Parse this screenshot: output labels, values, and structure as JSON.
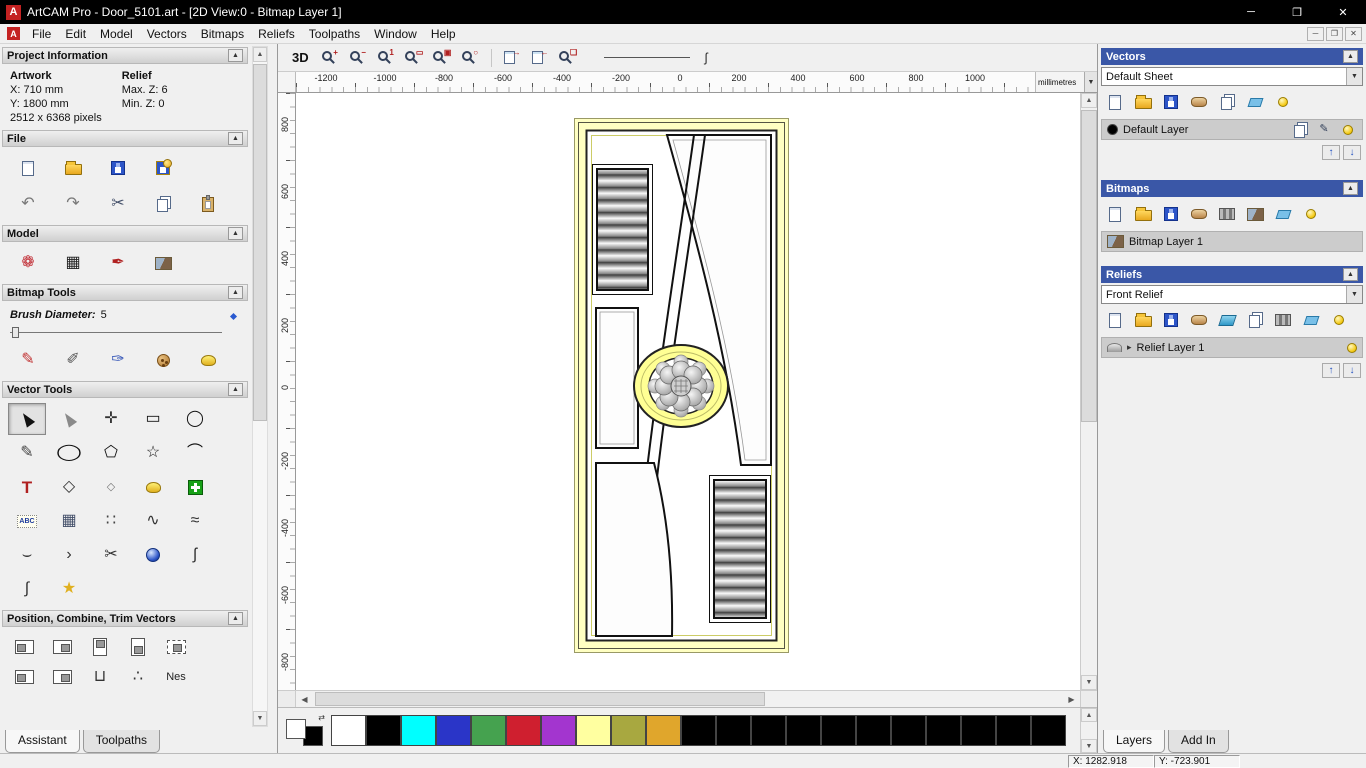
{
  "window": {
    "title": "ArtCAM Pro - Door_5101.art - [2D View:0 - Bitmap Layer 1]",
    "logo_letter": "A",
    "controls": {
      "minimize": "─",
      "restore": "❐",
      "close": "✕"
    }
  },
  "menu": {
    "items": [
      {
        "name": "menu-file",
        "label": "File"
      },
      {
        "name": "menu-edit",
        "label": "Edit"
      },
      {
        "name": "menu-model",
        "label": "Model"
      },
      {
        "name": "menu-vectors",
        "label": "Vectors"
      },
      {
        "name": "menu-bitmaps",
        "label": "Bitmaps"
      },
      {
        "name": "menu-reliefs",
        "label": "Reliefs"
      },
      {
        "name": "menu-toolpaths",
        "label": "Toolpaths"
      },
      {
        "name": "menu-window",
        "label": "Window"
      },
      {
        "name": "menu-help",
        "label": "Help"
      }
    ]
  },
  "ui": {
    "collapse_glyph": "▲",
    "combo_arrow": "▼",
    "scroll_up": "▲",
    "scroll_down": "▼",
    "scroll_left": "◀",
    "scroll_right": "▶",
    "layer_up": "↑",
    "layer_down": "↓",
    "expand_glyph": "▸",
    "swap_glyph": "⇄"
  },
  "left_panel": {
    "project_info": {
      "title": "Project Information",
      "artwork_label": "Artwork",
      "relief_label": "Relief",
      "x": "X: 710 mm",
      "y": "Y: 1800 mm",
      "max_z": "Max. Z: 6",
      "min_z": "Min. Z: 0",
      "pixels": "2512 x 6368 pixels"
    },
    "file": {
      "title": "File",
      "row1": [
        {
          "name": "new-model-icon",
          "cls": "ic-page"
        },
        {
          "name": "open-model-icon",
          "cls": "ic-folder"
        },
        {
          "name": "save-model-icon",
          "cls": "ic-disk"
        },
        {
          "name": "save-as-icon",
          "cls": "ic-disk2"
        }
      ],
      "row2": [
        {
          "name": "undo-icon",
          "glyph": "↶",
          "color": "#777777"
        },
        {
          "name": "redo-icon",
          "glyph": "↷",
          "color": "#777777"
        },
        {
          "name": "cut-icon",
          "glyph": "✂",
          "color": "#44506a"
        },
        {
          "name": "copy-icon",
          "cls": "ic-pages"
        },
        {
          "name": "paste-icon",
          "cls": "ic-clipboard"
        }
      ]
    },
    "model": {
      "title": "Model",
      "icons": [
        {
          "name": "shape-editor-icon",
          "glyph": "❁",
          "color": "#c02830"
        },
        {
          "name": "greyscale-preview-icon",
          "glyph": "▦",
          "color": "#222222"
        },
        {
          "name": "relief-painting-icon",
          "glyph": "✒",
          "color": "#b02020"
        },
        {
          "name": "preview-model-icon",
          "cls": "ic-pic"
        }
      ]
    },
    "bitmap_tools": {
      "title": "Bitmap Tools",
      "brush_label": "Brush Diameter:",
      "brush_value": "5",
      "icons": [
        {
          "name": "paint-brush-icon",
          "glyph": "✎",
          "color": "#c03030"
        },
        {
          "name": "paint-selective-icon",
          "glyph": "✐",
          "color": "#555555"
        },
        {
          "name": "eyedropper-icon",
          "glyph": "✑",
          "color": "#3858b8"
        },
        {
          "name": "cookie-cutter-icon",
          "cls": "ic-cookie"
        },
        {
          "name": "flood-fill-icon",
          "cls": "ic-blob-yellow"
        }
      ]
    },
    "vector_tools": {
      "title": "Vector Tools",
      "tools": [
        {
          "name": "select-vectors-icon",
          "cls": "ic-cursor",
          "active": true
        },
        {
          "name": "node-editing-icon",
          "cls": "ic-cursor2"
        },
        {
          "name": "transform-vectors-icon",
          "glyph": "✛",
          "color": "#333333"
        },
        {
          "name": "create-rectangle-icon",
          "glyph": "▭",
          "color": "#111111"
        },
        {
          "name": "create-circle-icon",
          "glyph": "◯",
          "color": "#111111"
        },
        {
          "name": "create-polyline-icon",
          "glyph": "✎",
          "color": "#444444"
        },
        {
          "name": "create-ellipse-icon",
          "glyph": "◯",
          "cls": "wide",
          "color": "#111111"
        },
        {
          "name": "create-polygon-icon",
          "glyph": "⬠",
          "color": "#111111"
        },
        {
          "name": "create-star-icon",
          "glyph": "☆",
          "color": "#111111"
        },
        {
          "name": "create-arc-icon",
          "glyph": "⌒",
          "color": "#111111"
        },
        {
          "name": "create-text-icon",
          "glyph": "T",
          "cls": "bold",
          "color": "#b02020"
        },
        {
          "name": "measure-icon",
          "glyph": "◇",
          "color": "#333333"
        },
        {
          "name": "offset-vectors-icon",
          "glyph": "◇",
          "cls": "sm",
          "color": "#777777"
        },
        {
          "name": "doodle-icon",
          "cls": "ic-blob-yellow"
        },
        {
          "name": "paste-special-icon",
          "cls": "ic-plus-green"
        },
        {
          "name": "text-block-icon",
          "glyph": "ABC",
          "cls": "ic-abc"
        },
        {
          "name": "create-grid-icon",
          "glyph": "▦",
          "color": "#44506a"
        },
        {
          "name": "block-paste-icon",
          "glyph": "∷",
          "color": "#444444"
        },
        {
          "name": "fit-polyline-icon",
          "glyph": "∿",
          "color": "#333333"
        },
        {
          "name": "fit-arcs-icon",
          "glyph": "≈",
          "color": "#333333"
        },
        {
          "name": "join-close-vectors-icon",
          "glyph": "⌣",
          "color": "#333333"
        },
        {
          "name": "extend-vectors-icon",
          "glyph": "›",
          "color": "#333333"
        },
        {
          "name": "trim-vectors-icon",
          "glyph": "✂",
          "color": "#333333"
        },
        {
          "name": "interactive-distortion-icon",
          "cls": "ic-sphere"
        },
        {
          "name": "fillet-icon",
          "glyph": "ʃ",
          "color": "#333333"
        },
        {
          "name": "vector-doctor-icon",
          "glyph": "∫",
          "color": "#333333"
        },
        {
          "name": "wrap-star-icon",
          "glyph": "★",
          "color": "#e0b020"
        }
      ]
    },
    "position_tools": {
      "title": "Position, Combine, Trim Vectors",
      "row1": [
        {
          "name": "align-left-icon",
          "cls": "ai-l"
        },
        {
          "name": "align-right-icon",
          "cls": "ai-r"
        },
        {
          "name": "align-top-icon",
          "cls": "ai-t"
        },
        {
          "name": "align-bottom-icon",
          "cls": "ai-b"
        },
        {
          "name": "align-centre-icon",
          "cls": "ai-c"
        }
      ],
      "row2": [
        {
          "name": "group-vectors-icon",
          "cls": "ai-l"
        },
        {
          "name": "ungroup-vectors-icon",
          "cls": "ai-r"
        },
        {
          "name": "weld-vectors-icon",
          "glyph": "⊔",
          "color": "#333333"
        },
        {
          "name": "snap-dots-icon",
          "glyph": "∴",
          "color": "#333333"
        },
        {
          "name": "nesting-icon",
          "glyph": "Nes",
          "cls": "sm",
          "color": "#222222"
        }
      ]
    },
    "tabs": [
      {
        "name": "tab-assistant",
        "label": "Assistant",
        "active": true
      },
      {
        "name": "tab-toolpaths",
        "label": "Toolpaths",
        "active": false
      }
    ]
  },
  "canvas": {
    "toolbar": {
      "view3d_label": "3D",
      "zoom_icons": [
        {
          "name": "zoom-in-icon",
          "cls": "ic-zoom",
          "badge": "+"
        },
        {
          "name": "zoom-out-icon",
          "cls": "ic-zoom",
          "badge": "−"
        },
        {
          "name": "zoom-1to1-icon",
          "cls": "ic-zoom",
          "badge": "1"
        },
        {
          "name": "zoom-window-icon",
          "cls": "ic-zoom",
          "badge": "▭"
        },
        {
          "name": "zoom-fit-icon",
          "cls": "ic-zoom",
          "badge": "▣"
        },
        {
          "name": "zoom-objects-icon",
          "cls": "ic-zoom",
          "badge": "○"
        }
      ],
      "snap_icons": [
        {
          "name": "snap-grid-toggle-icon",
          "cls": "ic-pagearrow",
          "badge": "→"
        },
        {
          "name": "snap-guides-toggle-icon",
          "cls": "ic-pagearrow",
          "badge": "←"
        },
        {
          "name": "zoom-page-icon",
          "cls": "ic-zoom",
          "badge": "❏"
        }
      ]
    },
    "ruler": {
      "h_labels": [
        "-1200",
        "-1000",
        "-800",
        "-600",
        "-400",
        "-200",
        "0",
        "200",
        "400",
        "600",
        "800",
        "1000"
      ],
      "v_labels": [
        "800",
        "600",
        "400",
        "200",
        "0",
        "-200",
        "-400",
        "-600",
        "-800"
      ],
      "units": "millimetres"
    }
  },
  "palette": {
    "colors": [
      "#ffffff",
      "#000000",
      "#00ffff",
      "#2a35c8",
      "#45a24f",
      "#cf1f2f",
      "#a335cf",
      "#ffffa0",
      "#a8a840",
      "#e0a62c",
      "#000000",
      "#000000",
      "#000000",
      "#000000",
      "#000000",
      "#000000",
      "#000000",
      "#000000",
      "#000000",
      "#000000",
      "#000000"
    ]
  },
  "right_panel": {
    "vectors": {
      "title": "Vectors",
      "sheet_value": "Default Sheet",
      "toolbar": [
        {
          "name": "new-vector-layer-icon",
          "cls": "ic-page"
        },
        {
          "name": "open-vector-layer-icon",
          "cls": "ic-folder"
        },
        {
          "name": "save-vector-layer-icon",
          "cls": "ic-disk"
        },
        {
          "name": "merge-vector-layers-icon",
          "cls": "ic-loaf"
        },
        {
          "name": "new-sheet-icon",
          "cls": "ic-pages"
        },
        {
          "name": "delete-vector-layer-icon",
          "cls": "ic-eraser"
        },
        {
          "name": "toggle-all-vector-visibility-icon",
          "cls": "ic-bulb"
        }
      ],
      "layer_label": "Default Layer",
      "layer_icons": [
        {
          "name": "snap-layer-icon",
          "cls": "ic-pages"
        },
        {
          "name": "edit-layer-colour-icon",
          "glyph": "✎",
          "color": "#33415a"
        },
        {
          "name": "layer-visibility-icon",
          "cls": "ic-bulb"
        }
      ]
    },
    "bitmaps": {
      "title": "Bitmaps",
      "toolbar": [
        {
          "name": "new-bitmap-layer-icon",
          "cls": "ic-page"
        },
        {
          "name": "open-bitmap-layer-icon",
          "cls": "ic-folder"
        },
        {
          "name": "save-bitmap-layer-icon",
          "cls": "ic-disk"
        },
        {
          "name": "merge-bitmap-layers-icon",
          "cls": "ic-loaf"
        },
        {
          "name": "convert-bitmap-icon",
          "cls": "ic-film"
        },
        {
          "name": "bitmap-preview-icon",
          "cls": "ic-pic"
        },
        {
          "name": "delete-bitmap-layer-icon",
          "cls": "ic-eraser"
        },
        {
          "name": "toggle-all-bitmap-visibility-icon",
          "cls": "ic-bulb"
        }
      ],
      "layer_label": "Bitmap Layer 1"
    },
    "reliefs": {
      "title": "Reliefs",
      "relief_value": "Front Relief",
      "toolbar": [
        {
          "name": "new-relief-layer-icon",
          "cls": "ic-page"
        },
        {
          "name": "open-relief-layer-icon",
          "cls": "ic-folder"
        },
        {
          "name": "save-relief-layer-icon",
          "cls": "ic-disk"
        },
        {
          "name": "merge-relief-layers-icon",
          "cls": "ic-loaf"
        },
        {
          "name": "relief-3d-preview-icon",
          "cls": "ic-grid3d"
        },
        {
          "name": "duplicate-relief-layer-icon",
          "cls": "ic-pages"
        },
        {
          "name": "relief-film-icon",
          "cls": "ic-film"
        },
        {
          "name": "delete-relief-layer-icon",
          "cls": "ic-eraser"
        },
        {
          "name": "toggle-all-relief-visibility-icon",
          "cls": "ic-bulb"
        }
      ],
      "layer_label": "Relief Layer 1"
    },
    "tabs": [
      {
        "name": "tab-layers",
        "label": "Layers",
        "active": true
      },
      {
        "name": "tab-add-in",
        "label": "Add In",
        "active": false
      }
    ]
  },
  "status_bar": {
    "x": "X: 1282.918",
    "y": "Y: -723.901"
  }
}
